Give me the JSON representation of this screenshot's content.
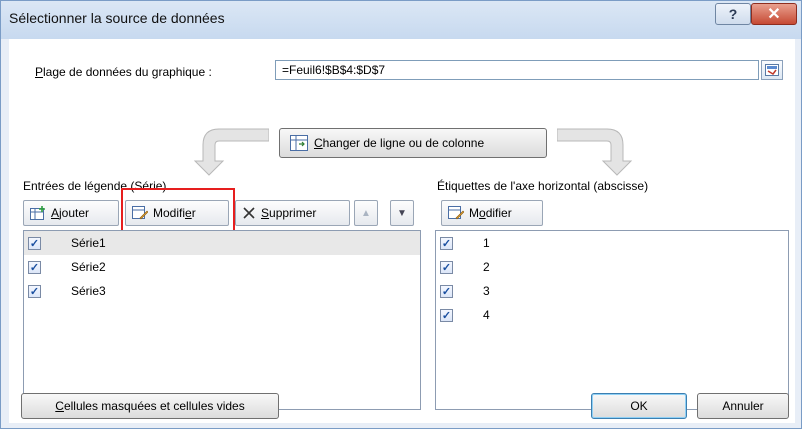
{
  "window": {
    "title": "Sélectionner la source de données",
    "help": "?",
    "close": "✕"
  },
  "range": {
    "label_prefix": "P",
    "label_rest": "lage de données du graphique :",
    "value": "=Feuil6!$B$4:$D$7"
  },
  "switch_button": {
    "label_prefix": "C",
    "label_rest": "hanger de ligne ou de colonne"
  },
  "legend": {
    "label": "Entrées de légende (Série)",
    "add": {
      "u": "A",
      "rest": "jouter"
    },
    "edit": {
      "pre": "Modifi",
      "u": "e",
      "rest": "r"
    },
    "remove": {
      "u": "S",
      "rest": "upprimer"
    },
    "up": "▲",
    "down": "▼",
    "series": [
      {
        "name": "Série1",
        "checked": true
      },
      {
        "name": "Série2",
        "checked": true
      },
      {
        "name": "Série3",
        "checked": true
      }
    ]
  },
  "axis": {
    "label": "Étiquettes de l'axe horizontal (abscisse)",
    "edit": {
      "pre": "M",
      "u": "o",
      "rest": "difier"
    },
    "items": [
      {
        "name": "1",
        "checked": true
      },
      {
        "name": "2",
        "checked": true
      },
      {
        "name": "3",
        "checked": true
      },
      {
        "name": "4",
        "checked": true
      }
    ]
  },
  "bottom": {
    "hidden_cells": {
      "u": "C",
      "rest": "ellules masquées et cellules vides"
    },
    "ok": "OK",
    "cancel": "Annuler"
  },
  "colors": {
    "title_bg": "#c7d9ef",
    "close_bg": "#c64a34",
    "highlight": "#e61e1e",
    "check": "#1a4fa0"
  },
  "icons": [
    "help-icon",
    "close-icon",
    "range-select-icon",
    "switch-rows-columns-icon",
    "add-series-icon",
    "edit-series-icon",
    "delete-x-icon",
    "edit-axis-icon",
    "checkbox-checked-icon"
  ]
}
